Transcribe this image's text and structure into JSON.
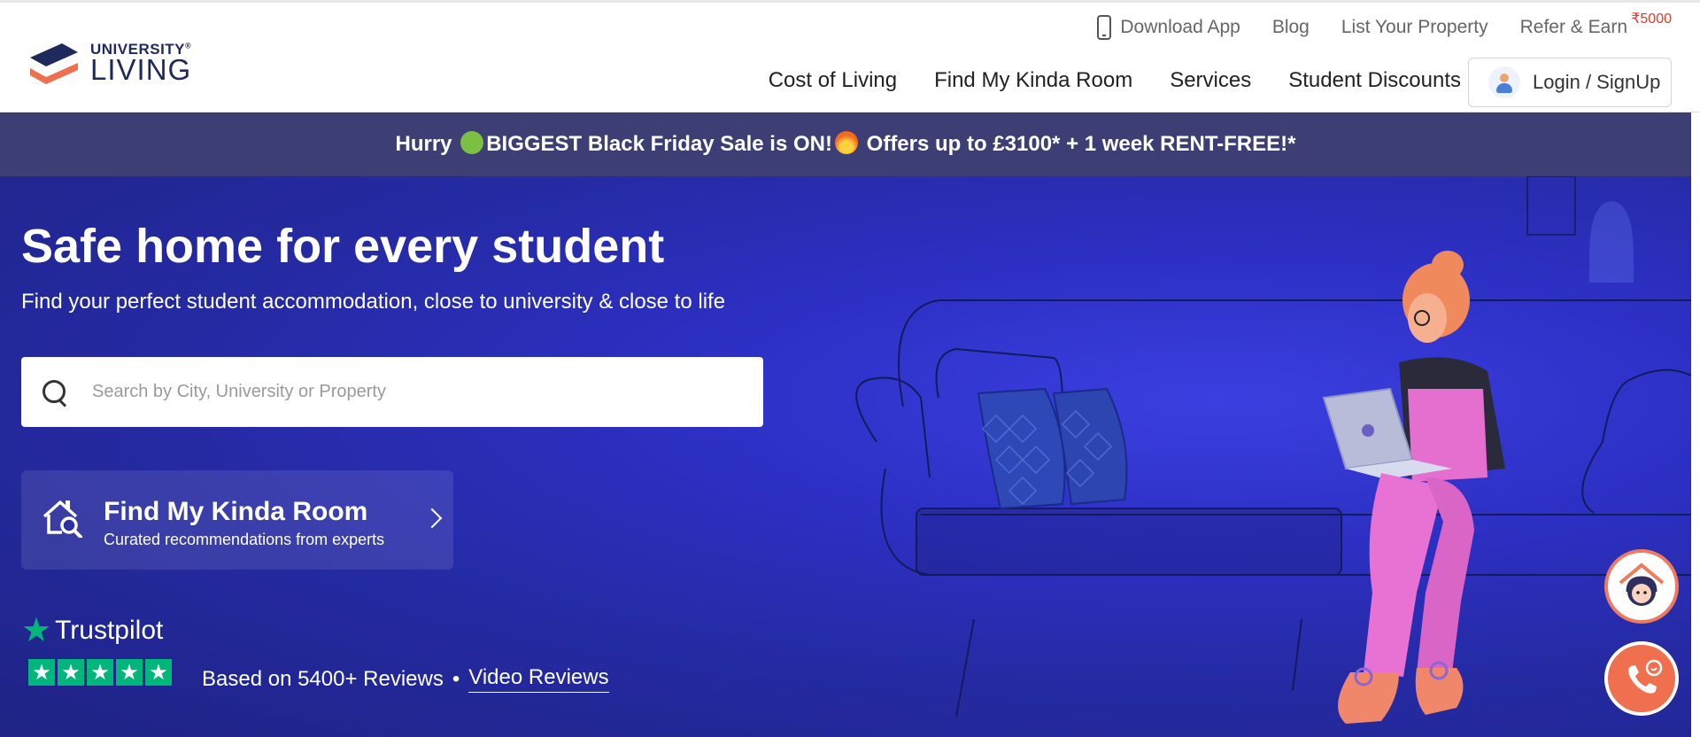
{
  "brand": {
    "line1": "UNIVERSITY",
    "line2": "LIVING",
    "reg": "®"
  },
  "top_links": {
    "download_app": "Download App",
    "blog": "Blog",
    "list_property": "List Your Property",
    "refer_earn": "Refer & Earn",
    "refer_badge": "₹5000"
  },
  "nav": {
    "cost_of_living": "Cost of Living",
    "find_my_kinda_room": "Find My Kinda Room",
    "services": "Services",
    "student_discounts": "Student Discounts",
    "login": "Login / SignUp"
  },
  "banner": {
    "part1": "Hurry ",
    "part2": "BIGGEST Black Friday Sale is ON!",
    "part3": " Offers up to £3100* + 1 week RENT-FREE!*"
  },
  "hero": {
    "title": "Safe home for every student",
    "subtitle": "Find your perfect student accommodation, close to university & close to life",
    "search_placeholder": "Search by City, University or Property",
    "search_value": ""
  },
  "fmkr": {
    "title": "Find My Kinda Room",
    "subtitle": "Curated recommendations from experts"
  },
  "trustpilot": {
    "brand": "Trustpilot",
    "reviews": "Based on 5400+ Reviews",
    "separator": "•",
    "video_reviews": "Video Reviews"
  },
  "colors": {
    "banner_bg": "#3d3f74",
    "hero_bg": "#2d30c4",
    "accent": "#ef6f4f",
    "trustpilot_green": "#00b67a"
  },
  "icons": [
    "phone-icon",
    "user-icon",
    "search-icon",
    "house-search-icon",
    "chevron-right-icon",
    "trustpilot-star-icon",
    "chatbot-icon",
    "phone-call-icon"
  ]
}
